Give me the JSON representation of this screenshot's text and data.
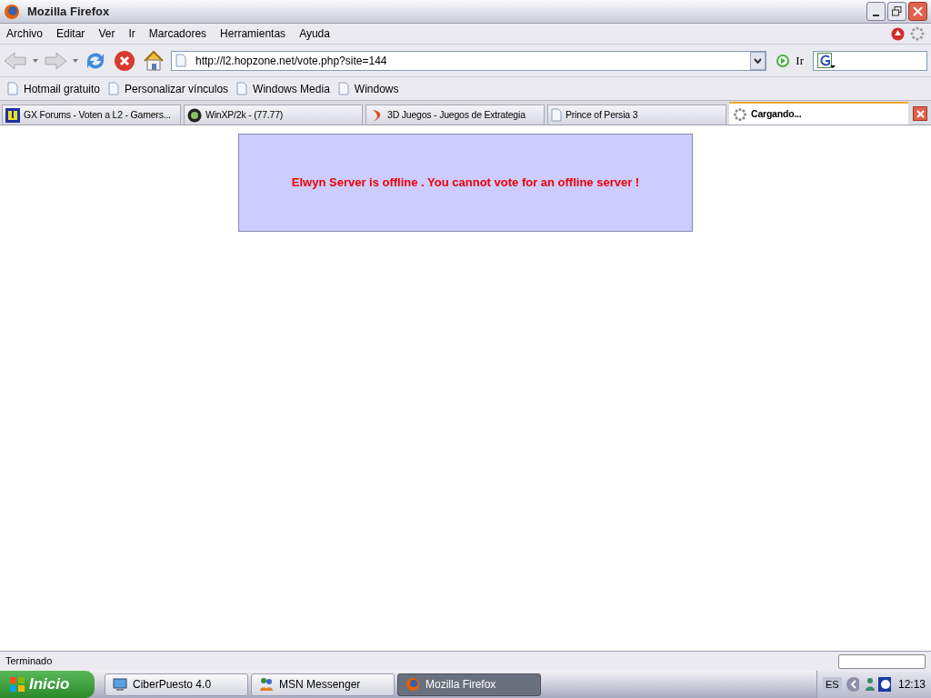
{
  "window": {
    "title": "Mozilla Firefox"
  },
  "menu": [
    "Archivo",
    "Editar",
    "Ver",
    "Ir",
    "Marcadores",
    "Herramientas",
    "Ayuda"
  ],
  "address": {
    "value": "http://l2.hopzone.net/vote.php?site=144",
    "go_label": "Ir"
  },
  "bookmarks": [
    "Hotmail gratuito",
    "Personalizar vínculos",
    "Windows Media",
    "Windows"
  ],
  "tabs": [
    {
      "label": "GX Forums - Voten a L2 - Gamers...",
      "selected": false
    },
    {
      "label": "WinXP/2k - (77.77)",
      "selected": false
    },
    {
      "label": "3D Juegos - Juegos de Extrategia",
      "selected": false
    },
    {
      "label": "Prince of Persia 3",
      "selected": false
    },
    {
      "label": "Cargando...",
      "selected": true
    }
  ],
  "page": {
    "message": "Elwyn Server is offline . You cannot vote for an offline server !"
  },
  "status_bar": {
    "text": "Terminado"
  },
  "taskbar": {
    "start": "Inicio",
    "items": [
      {
        "label": "CiberPuesto 4.0",
        "selected": false
      },
      {
        "label": "MSN Messenger",
        "selected": false
      },
      {
        "label": "Mozilla Firefox",
        "selected": true
      }
    ],
    "language": "ES",
    "clock": "12:13"
  }
}
